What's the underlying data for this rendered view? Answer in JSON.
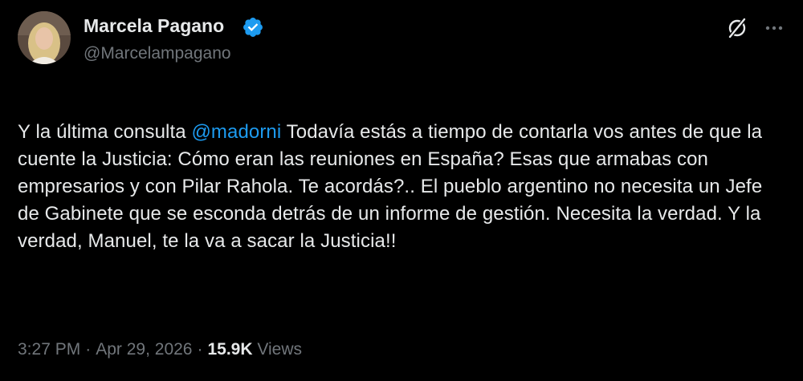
{
  "author": {
    "display_name": "Marcela Pagano",
    "handle": "@Marcelampagano",
    "verified": true
  },
  "tweet": {
    "text_before": "Y la última consulta ",
    "mention": "@madorni",
    "text_after": " Todavía estás a tiempo de contarla vos antes de que la cuente la Justicia: Cómo eran las reuniones en España? Esas que armabas con empresarios y con Pilar Rahola. Te acordás?.. El pueblo argentino no necesita un Jefe de Gabinete que se esconda detrás de un informe de gestión. Necesita la verdad. Y la verdad, Manuel, te la va a sacar la Justicia!!"
  },
  "meta": {
    "time": "3:27 PM",
    "separator": "·",
    "date": "Apr 29, 2026",
    "views_count": "15.9K",
    "views_label": "Views"
  },
  "icons": {
    "verified": "verified-badge-icon",
    "grok": "grok-icon",
    "more": "more-options-icon"
  },
  "colors": {
    "background": "#000000",
    "text_primary": "#e7e9ea",
    "text_secondary": "#71767b",
    "accent": "#1d9bf0"
  }
}
